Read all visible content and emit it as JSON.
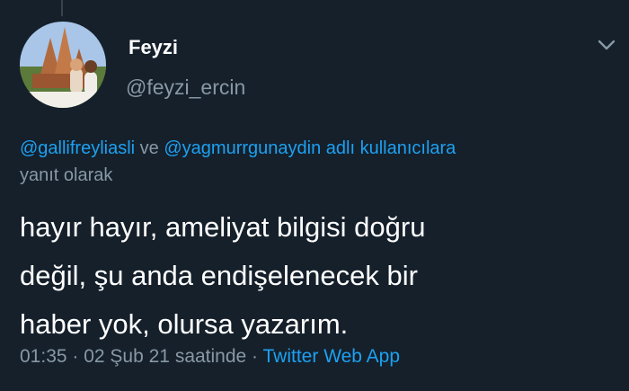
{
  "tweet": {
    "author": {
      "display_name": "Feyzi",
      "handle": "@feyzi_ercin"
    },
    "reply_to": {
      "mention_1": "@gallifreyliasli",
      "connector": " ve ",
      "mention_2": "@yagmurrgunaydin",
      "suffix": " adlı kullanıcılara",
      "second_line": "yanıt olarak"
    },
    "text_lines": [
      "hayır hayır, ameliyat bilgisi doğru",
      "değil, şu anda endişelenecek bir",
      "haber yok, olursa yazarım."
    ],
    "meta": {
      "time": "01:35",
      "separator": " · ",
      "date": "02 Şub 21 saatinde",
      "separator_2": " · ",
      "source": "Twitter Web App"
    }
  },
  "icons": {
    "more": "chevron-down-icon",
    "avatar": "profile-photo"
  },
  "colors": {
    "background": "#15202b",
    "text": "#ffffff",
    "secondary": "#8899a6",
    "accent": "#1da1f2"
  }
}
